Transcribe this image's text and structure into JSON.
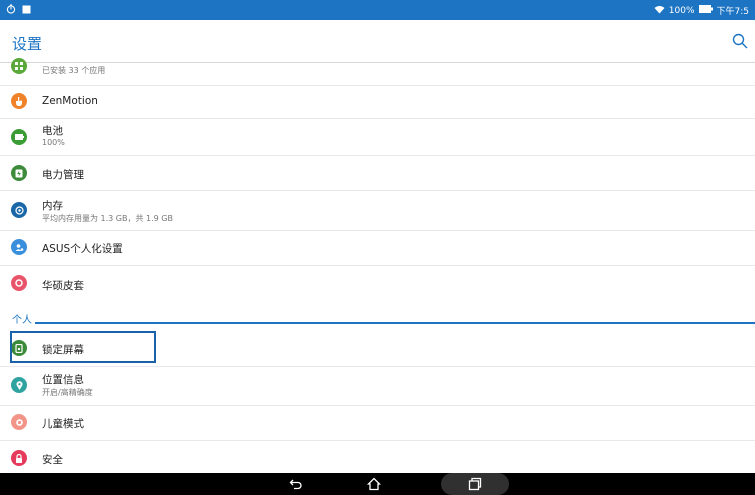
{
  "statusbar": {
    "battery_text": "100%",
    "time_text": "下午7:5"
  },
  "appbar": {
    "title": "设置"
  },
  "items": [
    {
      "name": "apps",
      "label": "",
      "sub": "已安装 33 个应用",
      "icon": "apps-icon",
      "color": "#5aa83a"
    },
    {
      "name": "zenmotion",
      "label": "ZenMotion",
      "sub": "",
      "icon": "hand-icon",
      "color": "#f0832a"
    },
    {
      "name": "battery",
      "label": "电池",
      "sub": "100%",
      "icon": "battery-icon",
      "color": "#3b9c35"
    },
    {
      "name": "power",
      "label": "电力管理",
      "sub": "",
      "icon": "power-management-icon",
      "color": "#3b8b3a"
    },
    {
      "name": "storage",
      "label": "内存",
      "sub": "平均内存用量为 1.3 GB，共 1.9 GB",
      "icon": "memory-icon",
      "color": "#1a67a8"
    },
    {
      "name": "asus",
      "label": "ASUS个人化设置",
      "sub": "",
      "icon": "personalization-icon",
      "color": "#3a8fdc"
    },
    {
      "name": "cover",
      "label": "华硕皮套",
      "sub": "",
      "icon": "cover-icon",
      "color": "#e8546a"
    }
  ],
  "section_personal": "个人",
  "personal_items": [
    {
      "name": "lockscreen",
      "label": "锁定屏幕",
      "sub": "",
      "icon": "lock-screen-icon",
      "color": "#3b8b3a"
    },
    {
      "name": "location",
      "label": "位置信息",
      "sub": "开启/高精确度",
      "icon": "location-icon",
      "color": "#2fa3a0"
    },
    {
      "name": "kids",
      "label": "儿童模式",
      "sub": "",
      "icon": "kids-mode-icon",
      "color": "#f29488"
    },
    {
      "name": "security",
      "label": "安全",
      "sub": "",
      "icon": "lock-icon",
      "color": "#e53b5c"
    }
  ]
}
